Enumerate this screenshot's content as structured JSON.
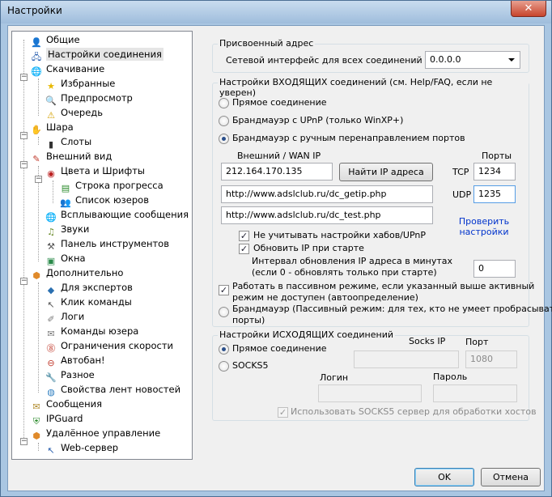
{
  "window": {
    "title": "Настройки",
    "close_glyph": "✕"
  },
  "tree": {
    "items": [
      {
        "label": "Общие",
        "icon": "user-plus-icon"
      },
      {
        "label": "Настройки соединения",
        "icon": "network-icon"
      },
      {
        "label": "Скачивание",
        "icon": "globe-download-icon"
      },
      {
        "label": "Избранные",
        "icon": "star-icon"
      },
      {
        "label": "Предпросмотр",
        "icon": "magnifier-icon"
      },
      {
        "label": "Очередь",
        "icon": "warning-icon"
      },
      {
        "label": "Шара",
        "icon": "share-hand-icon"
      },
      {
        "label": "Слоты",
        "icon": "bar-chart-icon"
      },
      {
        "label": "Внешний вид",
        "icon": "palette-icon"
      },
      {
        "label": "Цвета и Шрифты",
        "icon": "color-wheel-icon"
      },
      {
        "label": "Строка прогресса",
        "icon": "progress-icon"
      },
      {
        "label": "Список юзеров",
        "icon": "users-icon"
      },
      {
        "label": "Всплывающие сообщения",
        "icon": "globe-icon"
      },
      {
        "label": "Звуки",
        "icon": "music-note-icon"
      },
      {
        "label": "Панель инструментов",
        "icon": "hammer-icon"
      },
      {
        "label": "Окна",
        "icon": "windows-icon"
      },
      {
        "label": "Дополнительно",
        "icon": "cube-icon"
      },
      {
        "label": "Для экспертов",
        "icon": "expert-icon"
      },
      {
        "label": "Клик команды",
        "icon": "mouse-pointer-icon"
      },
      {
        "label": "Логи",
        "icon": "pencil-icon"
      },
      {
        "label": "Команды юзера",
        "icon": "command-icon"
      },
      {
        "label": "Ограничения скорости",
        "icon": "speed-limit-icon"
      },
      {
        "label": "Автобан!",
        "icon": "ban-icon"
      },
      {
        "label": "Разное",
        "icon": "wrench-icon"
      },
      {
        "label": "Свойства лент новостей",
        "icon": "news-icon"
      },
      {
        "label": "Сообщения",
        "icon": "messages-icon"
      },
      {
        "label": "IPGuard",
        "icon": "ipguard-icon"
      },
      {
        "label": "Удалённое управление",
        "icon": "remote-icon"
      },
      {
        "label": "Web-сервер",
        "icon": "web-server-icon"
      }
    ]
  },
  "assigned": {
    "group_label": "Присвоенный адрес",
    "iface_label": "Сетевой интерфейс для всех соединений",
    "iface_value": "0.0.0.0"
  },
  "incoming": {
    "group_label": "Настройки ВХОДЯЩИХ соединений (см. Help/FAQ, если не уверен)",
    "radio_direct": "Прямое соединение",
    "radio_upnp": "Брандмауэр с UPnP (только WinXP+)",
    "radio_manual": "Брандмауэр с ручным перенаправлением портов",
    "wan_ip_label": "Внешний / WAN IP",
    "ports_label": "Порты",
    "wan_ip_value": "212.164.170.135",
    "find_ip_button": "Найти IP адреса",
    "tcp_label": "TCP",
    "tcp_value": "1234",
    "udp_label": "UDP",
    "udp_value": "1235",
    "getip_url": "http://www.adslclub.ru/dc_getip.php",
    "test_url": "http://www.adslclub.ru/dc_test.php",
    "check_link": "Проверить настройки",
    "ignore_upnp": "Не учитывать настройки хабов/UPnP",
    "update_ip": "Обновить IP при старте",
    "interval_label_1": "Интервал обновления IP адреса в минутах",
    "interval_label_2": "(если 0 - обновлять только при старте)",
    "interval_value": "0",
    "passive_label_1": "Работать в пассивном режиме, если указанный выше активный",
    "passive_label_2": "режим не доступен (автоопределение)",
    "firewall_passive_1": "Брандмауэр (Пассивный режим: для тех, кто не умеет пробрасывать",
    "firewall_passive_2": "порты)"
  },
  "outgoing": {
    "group_label": "Настройки ИСХОДЯЩИХ соединений",
    "radio_direct": "Прямое соединение",
    "radio_socks": "SOCKS5",
    "socks_ip_label": "Socks IP",
    "port_label": "Порт",
    "port_value": "1080",
    "login_label": "Логин",
    "password_label": "Пароль",
    "use_socks_hosts": "Использовать SOCKS5 сервер для обработки хостов"
  },
  "footer": {
    "ok": "OK",
    "cancel": "Отмена"
  }
}
